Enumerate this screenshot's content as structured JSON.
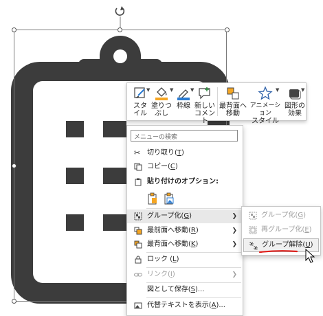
{
  "mini_toolbar": {
    "buttons": [
      {
        "label": "スタイル",
        "icon": "style-brush-icon"
      },
      {
        "label": "塗りつぶし",
        "icon": "fill-bucket-icon"
      },
      {
        "label": "枠線",
        "icon": "outline-pen-icon"
      },
      {
        "label": "新しいコメント",
        "icon": "new-comment-icon"
      },
      {
        "label": "最背面へ移動",
        "icon": "send-to-back-icon"
      },
      {
        "label": "アニメーションスタイル",
        "icon": "animation-star-icon"
      },
      {
        "label": "図形の効果",
        "icon": "shape-effects-icon"
      }
    ],
    "label_lines": {
      "style": [
        "スタ",
        "イル"
      ],
      "fill": [
        "塗りつ",
        "ぶし"
      ],
      "outline": [
        "枠線"
      ],
      "comment": [
        "新しい",
        "コメント"
      ],
      "back": [
        "最背面へ",
        "移動"
      ],
      "anim": [
        "アニメーション",
        "スタイル"
      ],
      "effects": [
        "図形の",
        "効果"
      ]
    }
  },
  "context_menu": {
    "search_placeholder": "メニューの検索",
    "cut": {
      "text": "切り取り(",
      "key": "T",
      "end": ")"
    },
    "copy": {
      "text": "コピー(",
      "key": "C",
      "end": ")"
    },
    "paste_options": "貼り付けのオプション:",
    "group": {
      "text": "グループ化(",
      "key": "G",
      "end": ")"
    },
    "bring_front": {
      "text": "最前面へ移動(",
      "key": "R",
      "end": ")"
    },
    "send_back": {
      "text": "最背面へ移動(",
      "key": "K",
      "end": ")"
    },
    "lock": {
      "text": "ロック (",
      "key": "L",
      "end": ")"
    },
    "link": {
      "text": "リンク(",
      "key": "I",
      "end": ")"
    },
    "save_as_picture": {
      "text": "図として保存(",
      "key": "S",
      "end": ")..."
    },
    "alt_text": {
      "text": "代替テキストを表示(",
      "key": "A",
      "end": ")..."
    }
  },
  "submenu": {
    "group": {
      "text": "グループ化(",
      "key": "G",
      "end": ")"
    },
    "regroup": {
      "text": "再グループ化(",
      "key": "E",
      "end": ")"
    },
    "ungroup": {
      "text": "グループ解除(",
      "key": "U",
      "end": ")"
    }
  },
  "colors": {
    "shape": "#3c3c3c",
    "hover": "#e8e8e8",
    "underline_red": "#e0201c",
    "fill_accent": "#f5a623",
    "outline_accent": "#2b7cd3"
  }
}
